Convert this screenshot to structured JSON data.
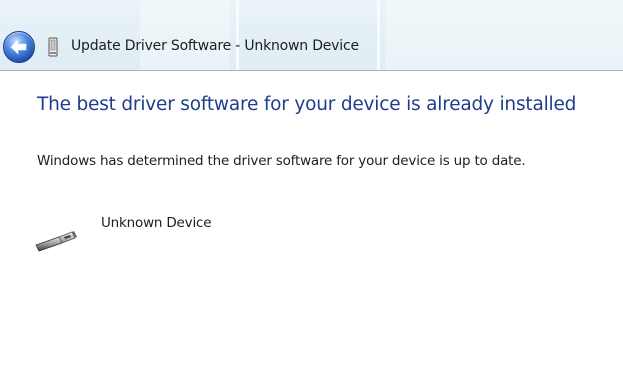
{
  "window": {
    "title": "Update Driver Software - Unknown Device"
  },
  "nav": {
    "back_icon": "back-arrow-icon",
    "device_icon": "device-icon"
  },
  "content": {
    "headline": "The best driver software for your device is already installed",
    "message": "Windows has determined the driver software for your device is up to date.",
    "device": {
      "icon": "usb-connector-icon",
      "name": "Unknown Device"
    }
  },
  "colors": {
    "headline": "#1f3d8c",
    "back_button": "#2a5cc0",
    "titlebar": "#e4f0f6"
  }
}
